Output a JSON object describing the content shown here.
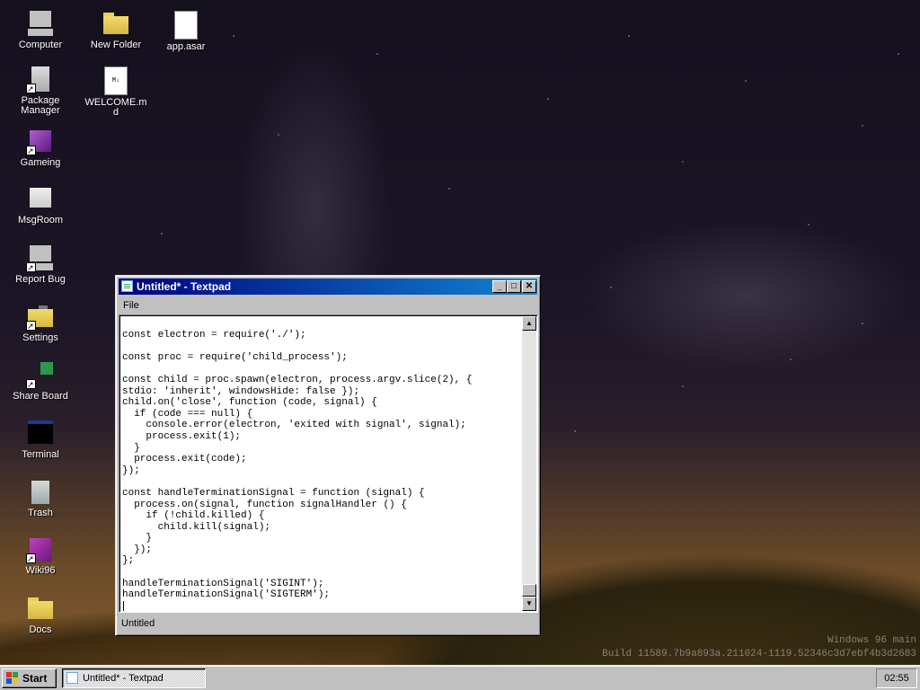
{
  "desktop": {
    "icons": [
      {
        "label": "Computer",
        "icon": "computer-icon"
      },
      {
        "label": "New Folder",
        "icon": "folder-icon"
      },
      {
        "label": "app.asar",
        "icon": "file-icon"
      },
      {
        "label": "Package Manager",
        "icon": "package-icon"
      },
      {
        "label": "WELCOME.md",
        "icon": "markdown-file-icon",
        "badge": "M↓"
      },
      {
        "label": "Gameing",
        "icon": "cube-icon"
      },
      {
        "label": "MsgRoom",
        "icon": "msgroom-icon"
      },
      {
        "label": "Report Bug",
        "icon": "computer-icon"
      },
      {
        "label": "Settings",
        "icon": "settings-folder-icon"
      },
      {
        "label": "Share Board",
        "icon": "share-board-icon"
      },
      {
        "label": "Terminal",
        "icon": "terminal-icon"
      },
      {
        "label": "Trash",
        "icon": "trash-icon"
      },
      {
        "label": "Wiki96",
        "icon": "help-book-icon"
      },
      {
        "label": "Docs",
        "icon": "folder-icon"
      }
    ],
    "watermark": {
      "line1": "Windows 96 main",
      "line2": "Build 11589.7b9a893a.211024-1119.52346c3d7ebf4b3d2683"
    }
  },
  "window": {
    "title": "Untitled* - Textpad",
    "controls": {
      "minimize": "_",
      "maximize": "□",
      "close": "✕"
    },
    "menu": [
      "File"
    ],
    "content": "\nconst electron = require('./');\n\nconst proc = require('child_process');\n\nconst child = proc.spawn(electron, process.argv.slice(2), {\nstdio: 'inherit', windowsHide: false });\nchild.on('close', function (code, signal) {\n  if (code === null) {\n    console.error(electron, 'exited with signal', signal);\n    process.exit(1);\n  }\n  process.exit(code);\n});\n\nconst handleTerminationSignal = function (signal) {\n  process.on(signal, function signalHandler () {\n    if (!child.killed) {\n      child.kill(signal);\n    }\n  });\n};\n\nhandleTerminationSignal('SIGINT');\nhandleTerminationSignal('SIGTERM');",
    "status": "Untitled"
  },
  "taskbar": {
    "start_label": "Start",
    "task_label": "Untitled* - Textpad",
    "clock": "02:55"
  },
  "colors": {
    "titlebar_start": "#000080",
    "titlebar_end": "#1084d0",
    "chrome": "#c0c0c0"
  }
}
